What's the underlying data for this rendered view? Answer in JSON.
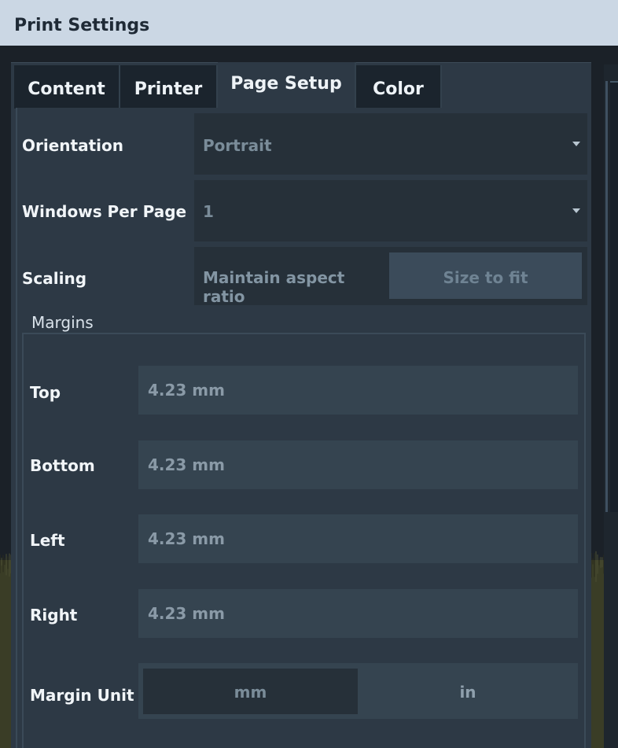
{
  "window": {
    "title": "Print Settings"
  },
  "tabs": [
    {
      "label": "Content",
      "active": false
    },
    {
      "label": "Printer",
      "active": false
    },
    {
      "label": "Page Setup",
      "active": true
    },
    {
      "label": "Color",
      "active": false
    }
  ],
  "page_setup": {
    "orientation": {
      "label": "Orientation",
      "value": "Portrait"
    },
    "windows_per_page": {
      "label": "Windows Per Page",
      "value": "1"
    },
    "scaling": {
      "label": "Scaling",
      "options": [
        "Maintain aspect ratio",
        "Size to fit"
      ],
      "selected": "Size to fit"
    },
    "margins": {
      "title": "Margins",
      "top": {
        "label": "Top",
        "value": "4.23 mm"
      },
      "bottom": {
        "label": "Bottom",
        "value": "4.23 mm"
      },
      "left": {
        "label": "Left",
        "value": "4.23 mm"
      },
      "right": {
        "label": "Right",
        "value": "4.23 mm"
      },
      "unit": {
        "label": "Margin Unit",
        "options": [
          "mm",
          "in"
        ],
        "selected": "mm"
      }
    }
  },
  "colors": {
    "titlebar": "#cbd7e4",
    "panel": "#2d3945",
    "field": "#263039",
    "input": "#354450",
    "noise": "#3a3d26"
  }
}
